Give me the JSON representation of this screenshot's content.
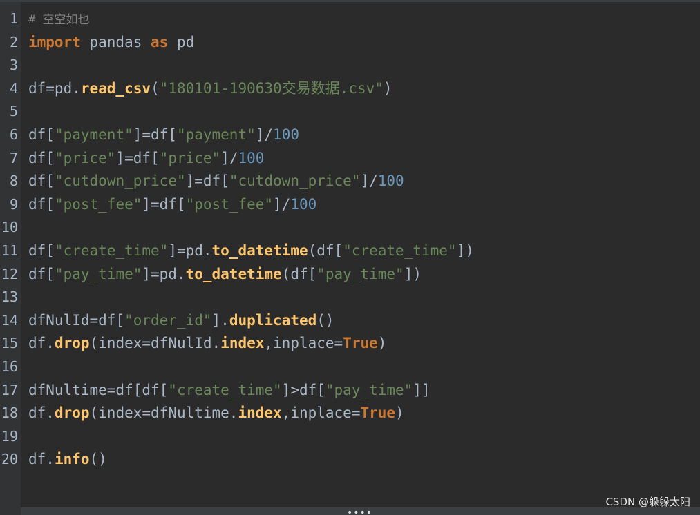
{
  "lines": [
    {
      "n": "1",
      "tokens": [
        {
          "t": "# 空空如也",
          "c": "cmt"
        }
      ]
    },
    {
      "n": "2",
      "tokens": [
        {
          "t": "import",
          "c": "kw"
        },
        {
          "t": " pandas ",
          "c": "plain"
        },
        {
          "t": "as",
          "c": "kw"
        },
        {
          "t": " pd",
          "c": "plain"
        }
      ]
    },
    {
      "n": "3",
      "tokens": []
    },
    {
      "n": "4",
      "tokens": [
        {
          "t": "df=pd.",
          "c": "plain"
        },
        {
          "t": "read_csv",
          "c": "fn"
        },
        {
          "t": "(",
          "c": "plain"
        },
        {
          "t": "\"180101-190630交易数据.csv\"",
          "c": "str"
        },
        {
          "t": ")",
          "c": "plain"
        }
      ]
    },
    {
      "n": "5",
      "tokens": []
    },
    {
      "n": "6",
      "tokens": [
        {
          "t": "df[",
          "c": "plain"
        },
        {
          "t": "\"payment\"",
          "c": "str"
        },
        {
          "t": "]=df[",
          "c": "plain"
        },
        {
          "t": "\"payment\"",
          "c": "str"
        },
        {
          "t": "]/",
          "c": "plain"
        },
        {
          "t": "100",
          "c": "num"
        }
      ]
    },
    {
      "n": "7",
      "tokens": [
        {
          "t": "df[",
          "c": "plain"
        },
        {
          "t": "\"price\"",
          "c": "str"
        },
        {
          "t": "]=df[",
          "c": "plain"
        },
        {
          "t": "\"price\"",
          "c": "str"
        },
        {
          "t": "]/",
          "c": "plain"
        },
        {
          "t": "100",
          "c": "num"
        }
      ]
    },
    {
      "n": "8",
      "tokens": [
        {
          "t": "df[",
          "c": "plain"
        },
        {
          "t": "\"cutdown_price\"",
          "c": "str"
        },
        {
          "t": "]=df[",
          "c": "plain"
        },
        {
          "t": "\"cutdown_price\"",
          "c": "str"
        },
        {
          "t": "]/",
          "c": "plain"
        },
        {
          "t": "100",
          "c": "num"
        }
      ]
    },
    {
      "n": "9",
      "tokens": [
        {
          "t": "df[",
          "c": "plain"
        },
        {
          "t": "\"post_fee\"",
          "c": "str"
        },
        {
          "t": "]=df[",
          "c": "plain"
        },
        {
          "t": "\"post_fee\"",
          "c": "str"
        },
        {
          "t": "]/",
          "c": "plain"
        },
        {
          "t": "100",
          "c": "num"
        }
      ]
    },
    {
      "n": "10",
      "tokens": []
    },
    {
      "n": "11",
      "tokens": [
        {
          "t": "df[",
          "c": "plain"
        },
        {
          "t": "\"create_time\"",
          "c": "str"
        },
        {
          "t": "]=pd.",
          "c": "plain"
        },
        {
          "t": "to_datetime",
          "c": "fn"
        },
        {
          "t": "(df[",
          "c": "plain"
        },
        {
          "t": "\"create_time\"",
          "c": "str"
        },
        {
          "t": "])",
          "c": "plain"
        }
      ]
    },
    {
      "n": "12",
      "tokens": [
        {
          "t": "df[",
          "c": "plain"
        },
        {
          "t": "\"pay_time\"",
          "c": "str"
        },
        {
          "t": "]=pd.",
          "c": "plain"
        },
        {
          "t": "to_datetime",
          "c": "fn"
        },
        {
          "t": "(df[",
          "c": "plain"
        },
        {
          "t": "\"pay_time\"",
          "c": "str"
        },
        {
          "t": "])",
          "c": "plain"
        }
      ]
    },
    {
      "n": "13",
      "tokens": []
    },
    {
      "n": "14",
      "tokens": [
        {
          "t": "dfNulId=df[",
          "c": "plain"
        },
        {
          "t": "\"order_id\"",
          "c": "str"
        },
        {
          "t": "].",
          "c": "plain"
        },
        {
          "t": "duplicated",
          "c": "fn"
        },
        {
          "t": "()",
          "c": "plain"
        }
      ]
    },
    {
      "n": "15",
      "tokens": [
        {
          "t": "df.",
          "c": "plain"
        },
        {
          "t": "drop",
          "c": "fn"
        },
        {
          "t": "(index=dfNulId.",
          "c": "plain"
        },
        {
          "t": "index",
          "c": "fn"
        },
        {
          "t": ",inplace=",
          "c": "plain"
        },
        {
          "t": "True",
          "c": "tru"
        },
        {
          "t": ")",
          "c": "plain"
        }
      ]
    },
    {
      "n": "16",
      "tokens": []
    },
    {
      "n": "17",
      "tokens": [
        {
          "t": "dfNultime=df[df[",
          "c": "plain"
        },
        {
          "t": "\"create_time\"",
          "c": "str"
        },
        {
          "t": "]>df[",
          "c": "plain"
        },
        {
          "t": "\"pay_time\"",
          "c": "str"
        },
        {
          "t": "]]",
          "c": "plain"
        }
      ]
    },
    {
      "n": "18",
      "tokens": [
        {
          "t": "df.",
          "c": "plain"
        },
        {
          "t": "drop",
          "c": "fn"
        },
        {
          "t": "(index=dfNultime.",
          "c": "plain"
        },
        {
          "t": "index",
          "c": "fn"
        },
        {
          "t": ",inplace=",
          "c": "plain"
        },
        {
          "t": "True",
          "c": "tru"
        },
        {
          "t": ")",
          "c": "plain"
        }
      ]
    },
    {
      "n": "19",
      "tokens": []
    },
    {
      "n": "20",
      "tokens": [
        {
          "t": "df.",
          "c": "plain"
        },
        {
          "t": "info",
          "c": "fn"
        },
        {
          "t": "()",
          "c": "plain"
        }
      ]
    }
  ],
  "resize_handle": "••••",
  "watermark": "CSDN @躲躲太阳",
  "colors": {
    "background": "#2b2b2b",
    "gutter": "#313335",
    "keyword": "#cc7832",
    "function": "#ffc66d",
    "string": "#6a8759",
    "number": "#6897bb",
    "comment": "#808080",
    "text": "#a9b7c6"
  }
}
